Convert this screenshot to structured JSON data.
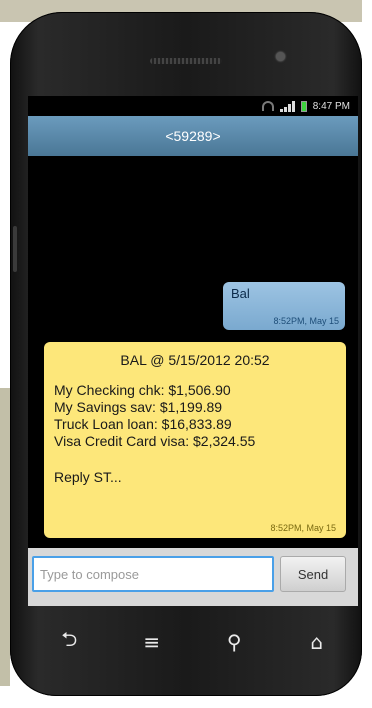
{
  "status_bar": {
    "time": "8:47 PM"
  },
  "conversation": {
    "title": "<59289>"
  },
  "messages": {
    "sent": {
      "text": "Bal",
      "time": "8:52PM, May 15"
    },
    "received": {
      "header": "BAL @ 5/15/2012 20:52",
      "lines": [
        "My Checking chk:  $1,506.90",
        "My Savings sav:  $1,199.89",
        "Truck Loan loan:  $16,833.89",
        "Visa Credit Card visa:  $2,324.55"
      ],
      "reply": "Reply ST...",
      "time": "8:52PM, May 15"
    }
  },
  "compose": {
    "placeholder": "Type to compose",
    "send_label": "Send"
  },
  "nav": {
    "back_icon": "back-icon",
    "menu_icon": "menu-icon",
    "search_icon": "search-icon",
    "home_icon": "home-icon"
  },
  "colors": {
    "title_bar": "#5a88aa",
    "sent_bubble": "#8ab6d9",
    "received_bubble": "#fde77a",
    "compose_border": "#4aa0e8"
  }
}
